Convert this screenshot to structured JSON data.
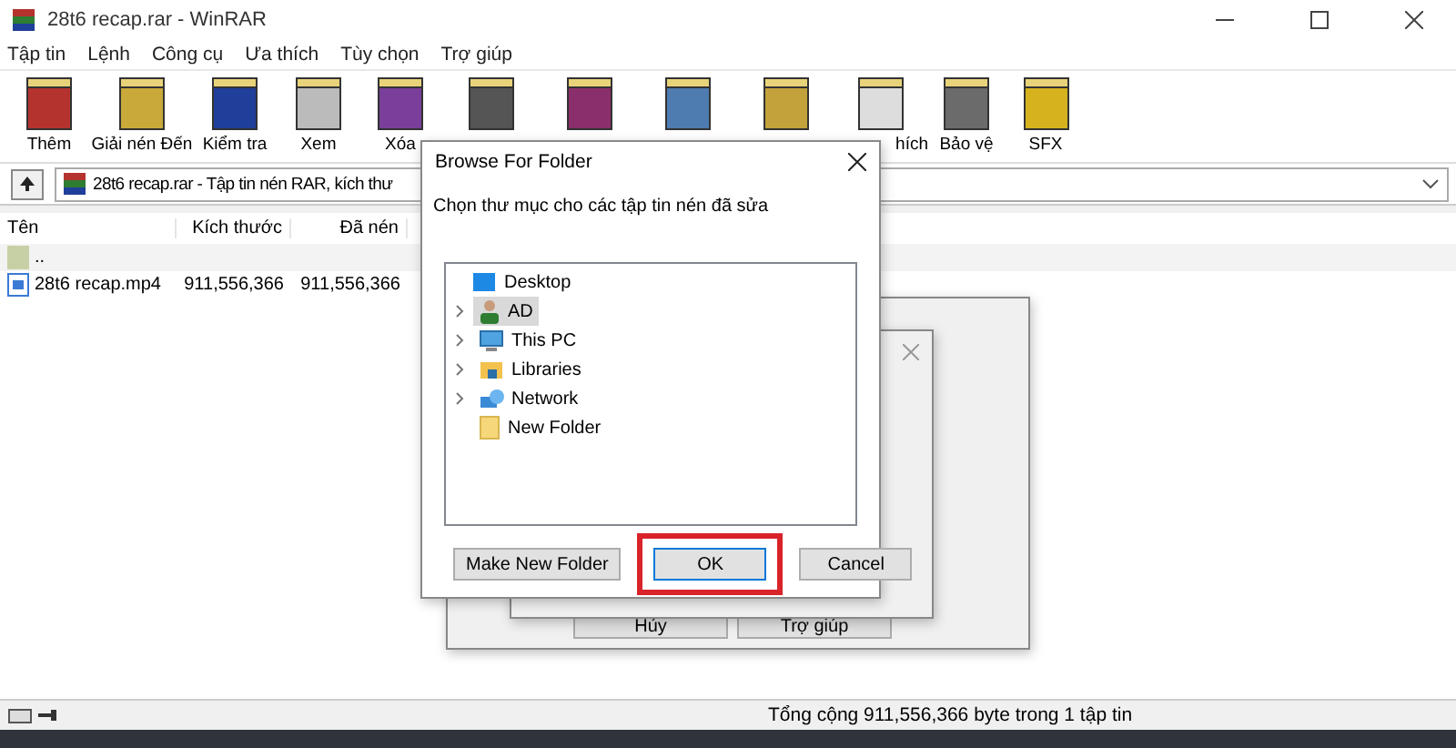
{
  "window": {
    "title": "28t6 recap.rar - WinRAR"
  },
  "menu": [
    "Tập tin",
    "Lệnh",
    "Công cụ",
    "Ưa thích",
    "Tùy chọn",
    "Trợ giúp"
  ],
  "toolbar": [
    {
      "kind": "labeled",
      "label": "Thêm"
    },
    {
      "kind": "labeled",
      "label": "Giải nén Đến"
    },
    {
      "kind": "labeled",
      "label": "Kiểm tra"
    },
    {
      "kind": "labeled",
      "label": "Xem"
    },
    {
      "kind": "labeled",
      "label": "Xóa"
    },
    {
      "kind": "icon"
    },
    {
      "kind": "icon"
    },
    {
      "kind": "icon"
    },
    {
      "kind": "icon"
    },
    {
      "kind": "labeled",
      "label": "hích"
    },
    {
      "kind": "labeled",
      "label": "Bảo vệ"
    },
    {
      "kind": "labeled",
      "label": "SFX"
    }
  ],
  "address": {
    "value": "28t6 recap.rar - Tập tin nén RAR, kích thư"
  },
  "table": {
    "columns": [
      "Tên",
      "Kích thước",
      "Đã nén"
    ],
    "rows": [
      {
        "name": "..",
        "kind": "folder",
        "size": "",
        "packed": ""
      },
      {
        "name": "28t6 recap.mp4",
        "kind": "video",
        "size": "911,556,366",
        "packed": "911,556,366"
      }
    ]
  },
  "status_bar": {
    "text": "Tổng cộng 911,556,366 byte trong 1 tập tin"
  },
  "back_dialog": {
    "buttons": [
      "Hủy",
      "Trợ giúp"
    ]
  },
  "browse_dialog": {
    "title": "Browse For Folder",
    "prompt": "Chọn thư mục cho các tập tin nén đã sửa",
    "tree": [
      {
        "label": "Desktop",
        "kind": "desktop",
        "selected": false,
        "expandable": false,
        "children": [
          {
            "label": "AD",
            "kind": "user",
            "selected": true,
            "expandable": true
          },
          {
            "label": "This PC",
            "kind": "pc",
            "selected": false,
            "expandable": true
          },
          {
            "label": "Libraries",
            "kind": "library",
            "selected": false,
            "expandable": true
          },
          {
            "label": "Network",
            "kind": "network",
            "selected": false,
            "expandable": true
          },
          {
            "label": "New Folder",
            "kind": "folder",
            "selected": false,
            "expandable": false
          }
        ]
      }
    ],
    "buttons": [
      {
        "label": "Make New Folder",
        "default": false,
        "highlight_frame": false
      },
      {
        "label": "OK",
        "default": true,
        "highlight_frame": true
      },
      {
        "label": "Cancel",
        "default": false,
        "highlight_frame": false
      }
    ]
  }
}
